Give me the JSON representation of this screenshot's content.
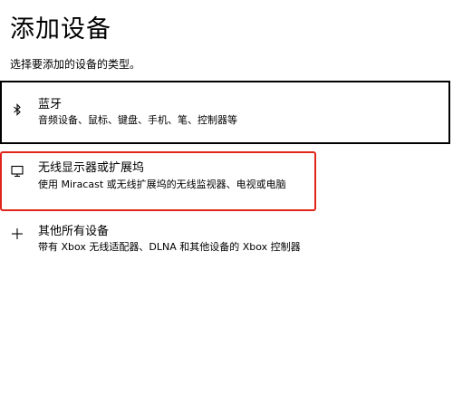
{
  "page": {
    "title": "添加设备",
    "subtitle": "选择要添加的设备的类型。"
  },
  "options": [
    {
      "label": "蓝牙",
      "description": "音频设备、鼠标、键盘、手机、笔、控制器等",
      "icon": "bluetooth-icon"
    },
    {
      "label": "无线显示器或扩展坞",
      "description": "使用 Miracast 或无线扩展坞的无线监视器、电视或电脑",
      "icon": "monitor-icon"
    },
    {
      "label": "其他所有设备",
      "description": "带有 Xbox 无线适配器、DLNA 和其他设备的 Xbox 控制器",
      "icon": "plus-icon"
    }
  ],
  "colors": {
    "selected_border": "#000000",
    "highlight_border": "#e1251b",
    "text": "#000000",
    "background": "#ffffff"
  }
}
